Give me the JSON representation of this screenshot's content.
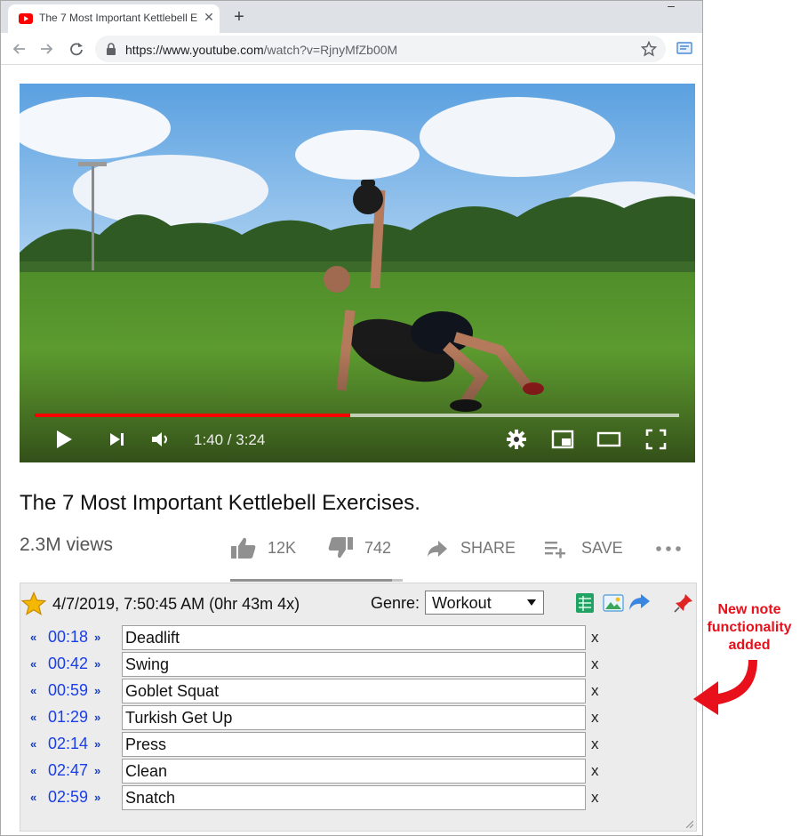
{
  "browser": {
    "tab_title": "The 7 Most Important Kettlebell E",
    "url_host": "https://www.youtube.com",
    "url_path": "/watch?v=RjnyMfZb00M"
  },
  "player": {
    "current_time": "1:40",
    "duration": "3:24",
    "time_display": "1:40 / 3:24",
    "progress_fraction": 0.49,
    "buffered_fraction": 1.0,
    "progress_color": "#ff0000"
  },
  "video_info": {
    "title": "The 7 Most Important Kettlebell Exercises.",
    "views": "2.3M views",
    "likes": "12K",
    "dislikes": "742",
    "share_label": "SHARE",
    "save_label": "SAVE",
    "like_fraction": 0.94
  },
  "notes_panel": {
    "date": "4/7/2019, 7:50:45 AM (0hr 43m 4x)",
    "genre_label": "Genre:",
    "genre_value": "Workout",
    "prev_glyph": "«",
    "next_glyph": "»",
    "delete_glyph": "x",
    "notes": [
      {
        "time": "00:18",
        "text": "Deadlift"
      },
      {
        "time": "00:42",
        "text": "Swing"
      },
      {
        "time": "00:59",
        "text": "Goblet Squat"
      },
      {
        "time": "01:29",
        "text": "Turkish Get Up"
      },
      {
        "time": "02:14",
        "text": "Press"
      },
      {
        "time": "02:47",
        "text": "Clean"
      },
      {
        "time": "02:59",
        "text": "Snatch"
      }
    ]
  },
  "annotation": {
    "line1": "New note",
    "line2": "functionality",
    "line3": "added",
    "color": "#e8101a"
  }
}
